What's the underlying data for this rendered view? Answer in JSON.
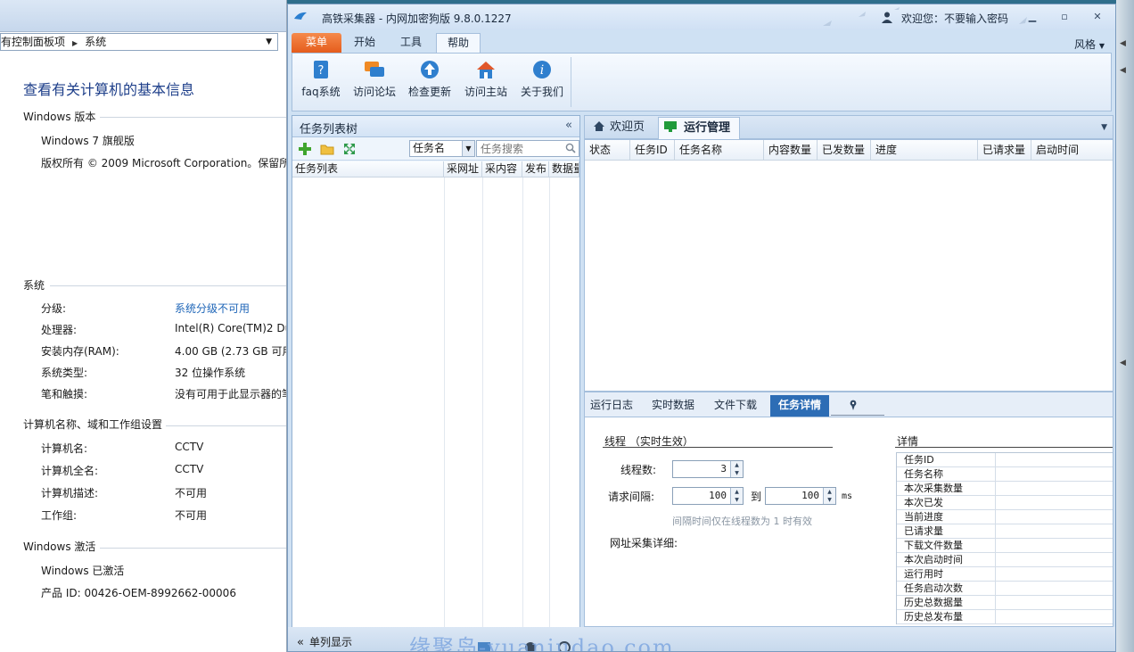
{
  "bg_window": {
    "address": {
      "crumb1": "有控制面板项",
      "crumb2": "系统"
    },
    "heading": "查看有关计算机的基本信息",
    "edition_section": "Windows 版本",
    "edition": "Windows 7 旗舰版",
    "copyright": "版权所有 © 2009 Microsoft Corporation。保留所",
    "system_section": "系统",
    "rows": [
      {
        "label": "分级:",
        "value": "系统分级不可用"
      },
      {
        "label": "处理器:",
        "value": "Intel(R) Core(TM)2 Du"
      },
      {
        "label": "安装内存(RAM):",
        "value": "4.00 GB (2.73 GB 可用"
      },
      {
        "label": "系统类型:",
        "value": "32 位操作系统"
      },
      {
        "label": "笔和触摸:",
        "value": "没有可用于此显示器的笔"
      }
    ],
    "computer_section": "计算机名称、域和工作组设置",
    "computer_rows": [
      {
        "label": "计算机名:",
        "value": "CCTV"
      },
      {
        "label": "计算机全名:",
        "value": "CCTV"
      },
      {
        "label": "计算机描述:",
        "value": "不可用"
      },
      {
        "label": "工作组:",
        "value": "不可用"
      }
    ],
    "activation_section": "Windows 激活",
    "activated": "Windows 已激活",
    "product_id": "产品 ID: 00426-OEM-8992662-00006"
  },
  "app": {
    "title": "高铁采集器 - 内网加密狗版 9.8.0.1227",
    "welcome": "欢迎您：不要输入密码",
    "skin": "风格",
    "ribbon_tabs": [
      "菜单",
      "开始",
      "工具",
      "帮助"
    ],
    "ribbon_buttons": [
      {
        "label": "faq系统",
        "icon": "faq-icon"
      },
      {
        "label": "访问论坛",
        "icon": "forum-icon"
      },
      {
        "label": "检查更新",
        "icon": "update-icon"
      },
      {
        "label": "访问主站",
        "icon": "home-icon"
      },
      {
        "label": "关于我们",
        "icon": "info-icon"
      }
    ]
  },
  "task_tree": {
    "title": "任务列表树",
    "field_select": "任务名",
    "search_placeholder": "任务搜索",
    "columns": [
      "任务列表",
      "采网址",
      "采内容",
      "发布",
      "数据量"
    ],
    "footer": "单列显示"
  },
  "doc_tabs": [
    "欢迎页",
    "运行管理"
  ],
  "run_grid": {
    "columns": [
      "状态",
      "任务ID",
      "任务名称",
      "内容数量",
      "已发数量",
      "进度",
      "已请求量",
      "启动时间"
    ]
  },
  "bottom_tabs": [
    "运行日志",
    "实时数据",
    "文件下载",
    "任务详情"
  ],
  "detail": {
    "thread_title": "线程 （实时生效）",
    "thread_count_label": "线程数:",
    "thread_count": "3",
    "interval_label": "请求间隔:",
    "interval_from": "100",
    "interval_to_label": "到",
    "interval_to": "100",
    "unit": "ms",
    "hint": "间隔时间仅在线程数为 1 时有效",
    "url_detail_label": "网址采集详细:",
    "detail_title": "详情",
    "detail_rows": [
      "任务ID",
      "任务名称",
      "本次采集数量",
      "本次已发",
      "当前进度",
      "已请求量",
      "下载文件数量",
      "本次启动时间",
      "运行用时",
      "任务启动次数",
      "历史总数据量",
      "历史总发布量"
    ]
  },
  "watermark": "缘聚岛-yuanjudao.com"
}
